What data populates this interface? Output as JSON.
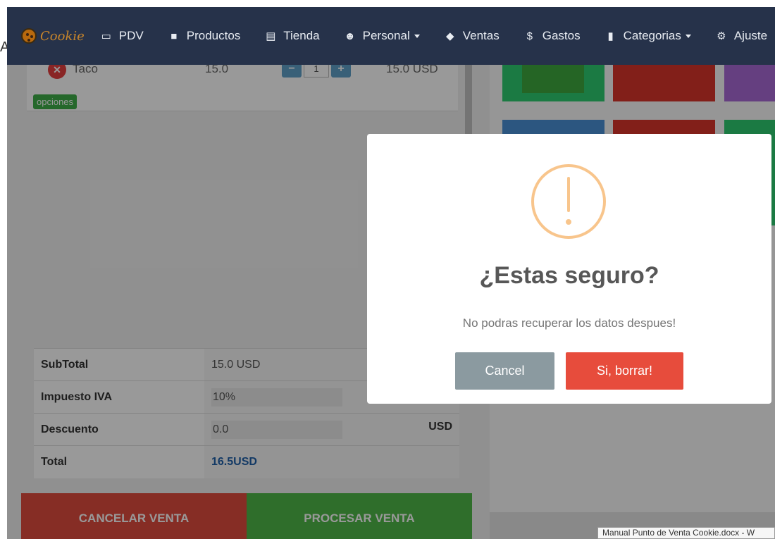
{
  "stray_text": "A",
  "navbar": {
    "brand": "Cookie",
    "items": [
      {
        "label": "PDV",
        "icon": "card-icon",
        "dropdown": false
      },
      {
        "label": "Productos",
        "icon": "box-icon",
        "dropdown": false
      },
      {
        "label": "Tienda",
        "icon": "store-icon",
        "dropdown": false
      },
      {
        "label": "Personal",
        "icon": "users-icon",
        "dropdown": true
      },
      {
        "label": "Ventas",
        "icon": "tag-icon",
        "dropdown": false
      },
      {
        "label": "Gastos",
        "icon": "dollar-icon",
        "dropdown": false
      },
      {
        "label": "Categorias",
        "icon": "bookmark-icon",
        "dropdown": true
      },
      {
        "label": "Ajuste",
        "icon": "cogs-icon",
        "dropdown": false
      }
    ]
  },
  "cart": {
    "items": [
      {
        "name": "Taco",
        "price": "15.0",
        "qty": "1",
        "total": "15.0 USD"
      }
    ],
    "options_label": "opciones"
  },
  "totals": {
    "subtotal_label": "SubTotal",
    "subtotal_value": "15.0 USD",
    "tax_label": "Impuesto IVA",
    "tax_value": "10%",
    "discount_label": "Descuento",
    "discount_value": "0.0",
    "discount_unit": "USD",
    "total_label": "Total",
    "total_value": "16.5USD"
  },
  "actions": {
    "cancel_sale": "CANCELAR VENTA",
    "process_sale": "PROCESAR VENTA"
  },
  "dialog": {
    "title": "¿Estas seguro?",
    "text": "No podras recuperar los datos despues!",
    "cancel_label": "Cancel",
    "confirm_label": "Si, borrar!",
    "icon": "warning-icon"
  },
  "tooltip": "Manual Punto de Venta Cookie.docx - W",
  "colors": {
    "navbar": "#26324a",
    "cancel_sale": "#e04b3f",
    "process_sale": "#4fb849",
    "dialog_confirm": "#e74c3c",
    "dialog_cancel": "#8b9aa0",
    "warning": "#f8c58c"
  }
}
